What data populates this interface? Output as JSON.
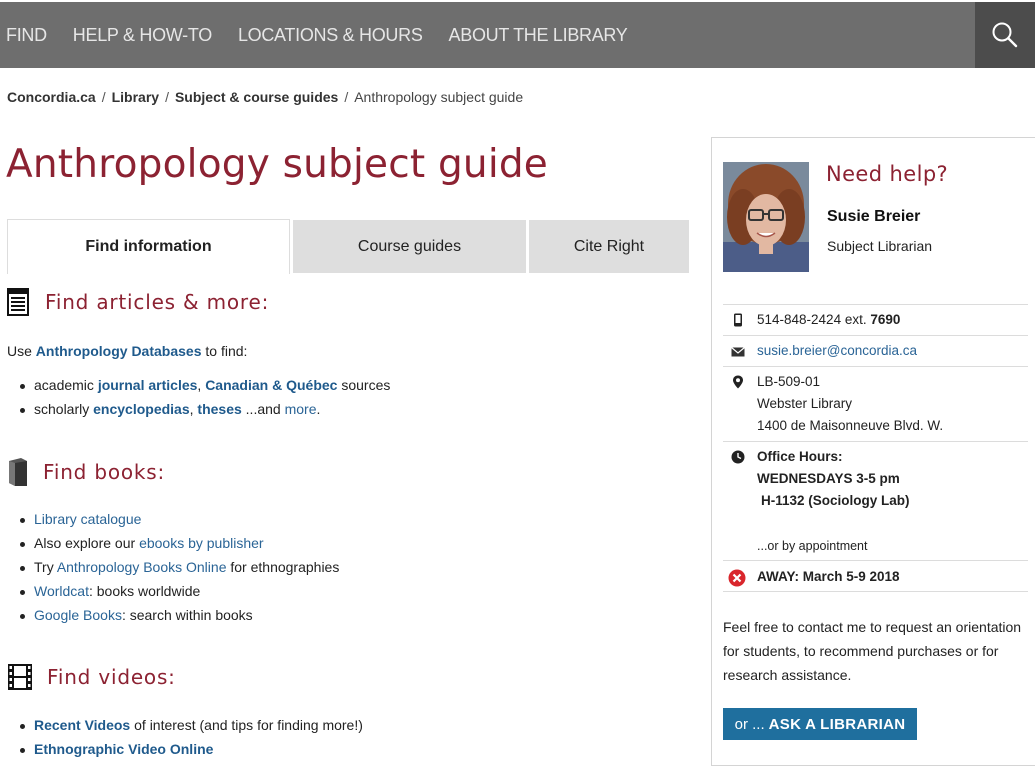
{
  "nav": {
    "items": [
      "FIND",
      "HELP & HOW-TO",
      "LOCATIONS & HOURS",
      "ABOUT THE LIBRARY"
    ]
  },
  "search_icon": "search-icon",
  "breadcrumb": {
    "items": [
      "Concordia.ca",
      "Library",
      "Subject & course guides"
    ],
    "current": "Anthropology subject guide"
  },
  "page_title": "Anthropology subject guide",
  "tabs": [
    "Find information",
    "Course guides",
    "Cite Right"
  ],
  "articles": {
    "heading": "Find articles & more:",
    "intro_pre": "Use ",
    "intro_link": "Anthropology Databases",
    "intro_post": " to find:",
    "line1": {
      "pre": "academic ",
      "link1": "journal articles",
      "mid": ", ",
      "link2": "Canadian & Québec",
      "post": " sources"
    },
    "line2": {
      "pre": "scholarly ",
      "link1": "encyclopedias",
      "mid": ", ",
      "link2": "theses",
      "post": " ...and ",
      "link3": "more",
      "end": "."
    }
  },
  "books": {
    "heading": "Find books:",
    "l1": {
      "link": "Library catalogue"
    },
    "l2": {
      "pre": "Also explore our ",
      "link": "ebooks by publisher"
    },
    "l3": {
      "pre": "Try ",
      "link": "Anthropology Books Online",
      "post": " for ethnographies"
    },
    "l4": {
      "link": "Worldcat",
      "post": ": books worldwide"
    },
    "l5": {
      "link": "Google Books",
      "post": ": search within books"
    }
  },
  "videos": {
    "heading": "Find videos:",
    "l1": {
      "link": "Recent Videos",
      "post": " of interest (and tips for finding more!)"
    },
    "l2": {
      "link": "Ethnographic Video Online"
    }
  },
  "sidebar": {
    "heading": "Need help?",
    "name": "Susie Breier",
    "role": "Subject Librarian",
    "phone": "514-848-2424 ext. ",
    "phone_ext": "7690",
    "email": "susie.breier@concordia.ca",
    "address": [
      "LB-509-01",
      "Webster Library",
      "1400 de Maisonneuve Blvd. W."
    ],
    "hours_label": "Office Hours:",
    "hours_day": "WEDNESDAYS 3-5 pm",
    "hours_room": "H-1132 (Sociology Lab)",
    "appointment": "...or by appointment",
    "away": "AWAY:  March 5-9 2018",
    "blurb": "Feel free to contact me to request an orientation for students, to recommend purchases or for research assistance.",
    "ask_pre": "or ...",
    "ask_label": "ASK A LIBRARIAN"
  },
  "colors": {
    "accent": "#8c2232",
    "link": "#2a6496",
    "nav_bg": "#6e6e6e",
    "button": "#1f6f9e",
    "away": "#d9262c"
  }
}
